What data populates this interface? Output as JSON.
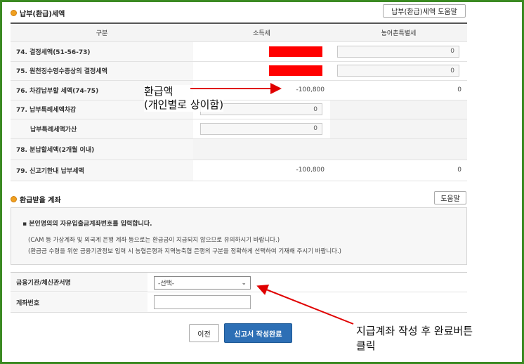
{
  "payment": {
    "title": "납부(환급)세액",
    "help_button": "납부(환급)세액 도움말",
    "columns": [
      "구분",
      "소득세",
      "농어촌특별세"
    ],
    "rows": [
      {
        "label": "74. 결정세액(51-56-73)",
        "income": "",
        "rural": "0"
      },
      {
        "label": "75. 원천징수영수증상의 결정세액",
        "income": "",
        "rural": "0"
      },
      {
        "label": "76. 차감납부할 세액(74-75)",
        "income": "-100,800",
        "rural": "0"
      },
      {
        "label": "77. 납부특례세액차감",
        "income": "0",
        "rural": ""
      },
      {
        "label": "납부특례세액가산",
        "income": "0",
        "rural": ""
      },
      {
        "label": "78. 분납할세액(2개월 이내)",
        "income": "",
        "rural": ""
      },
      {
        "label": "79. 신고기한내 납부세액",
        "income": "-100,800",
        "rural": "0"
      }
    ]
  },
  "refund": {
    "title": "환급받을 계좌",
    "help_button": "도움말",
    "notice_title": "본인명의의 자유입출금계좌번호를 입력합니다.",
    "notice_lines": [
      "(CAM 등 가상계좌 및 외국계 은행 계좌 등으로는 환급금이 지급되지 않으므로 유의하시기 바랍니다.)",
      "(환급금 수령을 위한 금융기관정보 입력 시 농협은행과 지역농축협 은행의 구분을 정확하게 선택하여 기재해 주시기 바랍니다.)"
    ],
    "bank_label": "금융기관/체신관서명",
    "bank_selected": "-선택-",
    "account_label": "계좌번호",
    "account_value": ""
  },
  "footer": {
    "prev_button": "이전",
    "submit_button": "신고서 작성완료"
  },
  "annotations": {
    "refund_amount_line1": "환급액",
    "refund_amount_line2": "(개인별로 상이함)",
    "account_note_line1": "지급계좌 작성 후 완료버튼",
    "account_note_line2": "클릭"
  },
  "colors": {
    "frame": "#3b8a22",
    "primary_button": "#2d6fb5",
    "redaction": "#ff0000",
    "arrow": "#e00000"
  }
}
